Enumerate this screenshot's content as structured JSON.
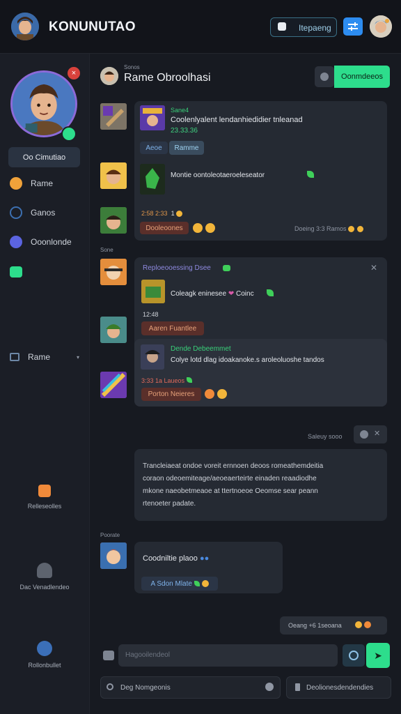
{
  "header": {
    "brand": "KONUNUTAO",
    "pill_label": "Itepaeng",
    "colors": {
      "accent": "#2ddd8c",
      "blue": "#2d8cf0"
    }
  },
  "sidebar": {
    "active_label": "Oo Cimutiao",
    "items": [
      {
        "label": "Rame",
        "icon": "coin-icon"
      },
      {
        "label": "Ganos",
        "icon": "controller-icon"
      },
      {
        "label": "Ooonlonde",
        "icon": "globe-icon"
      },
      {
        "label": "",
        "icon": "robot-icon"
      }
    ],
    "section_label": "Rame",
    "bottom_items": [
      {
        "label": "Relleseolles",
        "icon": "house-icon"
      },
      {
        "label": "Dac Venadlendeo",
        "icon": "ghost-icon"
      },
      {
        "label": "Rollonbullet",
        "icon": "discord-icon"
      }
    ]
  },
  "channel": {
    "title_small": "Sonos",
    "title": "Rame Obroolhasi",
    "action": "Oonmdeeos"
  },
  "thread1": {
    "user1": "Sane4",
    "line1": "Coolenlyalent lendanhiedidier tnleanad",
    "line2": "23.33.36",
    "tags": [
      "Aeoe",
      "Ramme"
    ],
    "line3": "Montie oontoleotaeroeleseator",
    "meta1": "2:58 2:33",
    "meta2": "1",
    "tag3": "Dooleoones",
    "footer": "Doeing 3:3 Ramos"
  },
  "section2_label": "Sone",
  "thread2": {
    "title": "Reploeooessing Dsee",
    "line1": "Coleagk eninesee",
    "line1b": "Coinc",
    "meta": "12:48",
    "tag": "Aaren Fuantlee",
    "user2": "Dende Debeemmet",
    "line2": "Colye lotd dlag idoakanoke.s aroleoluoshe tandos",
    "meta2": "3:33 1a Laueos",
    "tag2": "Porton Neieres"
  },
  "separator": "Saleuy sooo",
  "long_msg": [
    "Trancleiaeat ondoe voreit ernnoen deoos romeathemdeitia",
    "coraon odeoemiteage/aeoeaerteirte einaden reaadiodhe",
    "mkone naeobetmeaoe at ttertnoeoe Oeomse sear peann",
    "rtenoeter padate."
  ],
  "reply_label": "Poorate",
  "reply": {
    "text": "Coodniltie plaoo",
    "tag": "A Sdon Mlate"
  },
  "status_pill": "Oeang +6 1seoana",
  "composer": {
    "placeholder": "Hagooilendeol",
    "bottom_left": "Deg Nomgeonis",
    "bottom_right": "Deolionesdendendies"
  }
}
